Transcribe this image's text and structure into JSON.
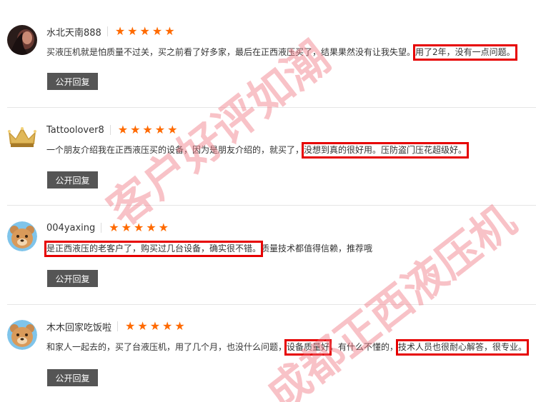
{
  "reviews": [
    {
      "username": "水北天南888",
      "rating": 5,
      "avatar": "dark-photo-avatar",
      "text_before": "买液压机就是怕质量不过关，买之前看了好多家，最后在正西液压买了，结果果然没有让我失望。",
      "text_highlight": "用了2年，没有一点问题。",
      "reply_label": "公开回复"
    },
    {
      "username": "Tattoolover8",
      "rating": 5,
      "avatar": "gold-crown-avatar",
      "text_before": "一个朋友介绍我在正西液压买的设备，因为是朋友介绍的，就买了，",
      "text_highlight": "没想到真的很好用。压防盗门压花超级好。",
      "reply_label": "公开回复"
    },
    {
      "username": "004yaxing",
      "rating": 5,
      "avatar": "bear-avatar",
      "text_highlight": "是正西液压的老客户了，购买过几台设备，确实很不错。",
      "text_after": "质量技术都值得信赖，推荐哦",
      "reply_label": "公开回复"
    },
    {
      "username": "木木回家吃饭啦",
      "rating": 5,
      "avatar": "bear-avatar",
      "text_before": "和家人一起去的，买了台液压机，用了几个月，也没什么问题，",
      "text_highlight": "设备质量好",
      "text_middle": "，有什么不懂的，",
      "text_highlight2": "技术人员也很耐心解答，很专业。",
      "reply_label": "公开回复"
    }
  ],
  "watermarks": {
    "top": "客户好评如潮",
    "bottom": "成都正西液压机"
  },
  "colors": {
    "star": "#ff6a00",
    "highlight_border": "#e60000",
    "button_bg": "#555555",
    "watermark": "#f07882"
  }
}
